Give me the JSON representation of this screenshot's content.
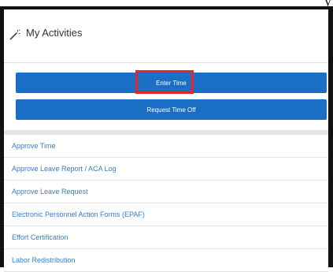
{
  "corner_text": "y",
  "header": {
    "title": "My Activities",
    "icon": "magic-wand-icon"
  },
  "buttons": {
    "enter_time": "Enter Time",
    "request_time_off": "Request Time Off"
  },
  "colors": {
    "button_bg": "#1a6fc4",
    "link": "#3a7cc6",
    "highlight": "#e3262e"
  },
  "activities": [
    "Approve Time",
    "Approve Leave Report / ACA Log",
    "Approve Leave Request",
    "Electronic Personnel Action Forms (EPAF)",
    "Effort Certification",
    "Labor Redistribution"
  ]
}
